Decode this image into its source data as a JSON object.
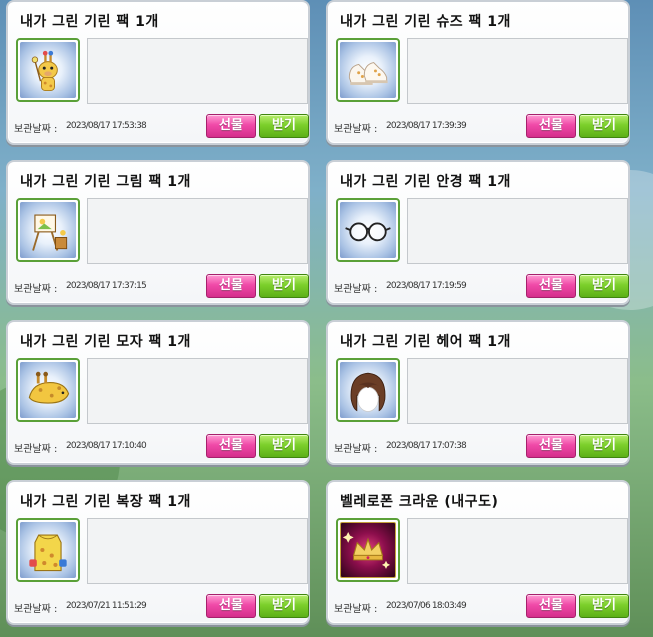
{
  "labels": {
    "date_label": "보관날짜 :",
    "gift_button": "선물",
    "receive_button": "받기"
  },
  "items": [
    {
      "name": "내가 그린 기린 팩 1개",
      "date": "2023/08/17 17:53:38",
      "icon": "giraffe-doll-icon"
    },
    {
      "name": "내가 그린 기린 슈즈 팩 1개",
      "date": "2023/08/17 17:39:39",
      "icon": "shoes-icon"
    },
    {
      "name": "내가 그린 기린 그림 팩 1개",
      "date": "2023/08/17 17:37:15",
      "icon": "easel-painting-icon"
    },
    {
      "name": "내가 그린 기린 안경 팩 1개",
      "date": "2023/08/17 17:19:59",
      "icon": "glasses-icon"
    },
    {
      "name": "내가 그린 기린 모자 팩 1개",
      "date": "2023/08/17 17:10:40",
      "icon": "giraffe-hat-icon"
    },
    {
      "name": "내가 그린 기린 헤어 팩 1개",
      "date": "2023/08/17 17:07:38",
      "icon": "brown-hair-icon"
    },
    {
      "name": "내가 그린 기린 복장 팩 1개",
      "date": "2023/07/21 11:51:29",
      "icon": "giraffe-outfit-icon"
    },
    {
      "name": "벨레로폰 크라운 (내구도)",
      "date": "2023/07/06 18:03:49",
      "icon": "crown-icon"
    }
  ]
}
